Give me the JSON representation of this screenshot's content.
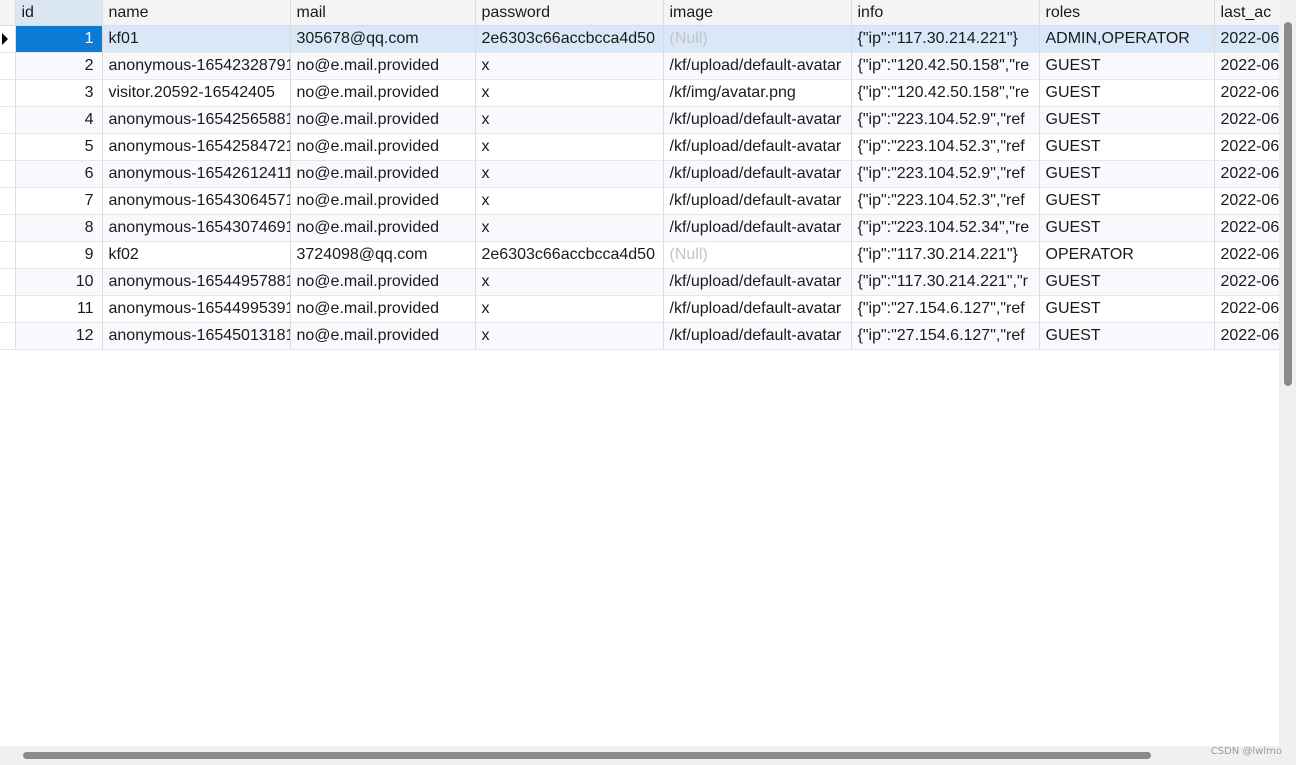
{
  "columns": [
    "id",
    "name",
    "mail",
    "password",
    "image",
    "info",
    "roles",
    "last_ac"
  ],
  "rows": [
    {
      "id": "1",
      "name": "kf01",
      "mail": "305678@qq.com",
      "password": "2e6303c66accbcca4d50",
      "image": "(Null)",
      "info": "{\"ip\":\"117.30.214.221\"}",
      "roles": "ADMIN,OPERATOR",
      "last_ac": "2022-06"
    },
    {
      "id": "2",
      "name": "anonymous-16542328791",
      "mail": "no@e.mail.provided",
      "password": "x",
      "image": "/kf/upload/default-avatar",
      "info": "{\"ip\":\"120.42.50.158\",\"re",
      "roles": "GUEST",
      "last_ac": "2022-06"
    },
    {
      "id": "3",
      "name": "visitor.20592-16542405",
      "mail": "no@e.mail.provided",
      "password": "x",
      "image": "/kf/img/avatar.png",
      "info": "{\"ip\":\"120.42.50.158\",\"re",
      "roles": "GUEST",
      "last_ac": "2022-06"
    },
    {
      "id": "4",
      "name": "anonymous-16542565881",
      "mail": "no@e.mail.provided",
      "password": "x",
      "image": "/kf/upload/default-avatar",
      "info": "{\"ip\":\"223.104.52.9\",\"ref",
      "roles": "GUEST",
      "last_ac": "2022-06"
    },
    {
      "id": "5",
      "name": "anonymous-16542584721",
      "mail": "no@e.mail.provided",
      "password": "x",
      "image": "/kf/upload/default-avatar",
      "info": "{\"ip\":\"223.104.52.3\",\"ref",
      "roles": "GUEST",
      "last_ac": "2022-06"
    },
    {
      "id": "6",
      "name": "anonymous-16542612411",
      "mail": "no@e.mail.provided",
      "password": "x",
      "image": "/kf/upload/default-avatar",
      "info": "{\"ip\":\"223.104.52.9\",\"ref",
      "roles": "GUEST",
      "last_ac": "2022-06"
    },
    {
      "id": "7",
      "name": "anonymous-16543064571",
      "mail": "no@e.mail.provided",
      "password": "x",
      "image": "/kf/upload/default-avatar",
      "info": "{\"ip\":\"223.104.52.3\",\"ref",
      "roles": "GUEST",
      "last_ac": "2022-06"
    },
    {
      "id": "8",
      "name": "anonymous-16543074691",
      "mail": "no@e.mail.provided",
      "password": "x",
      "image": "/kf/upload/default-avatar",
      "info": "{\"ip\":\"223.104.52.34\",\"re",
      "roles": "GUEST",
      "last_ac": "2022-06"
    },
    {
      "id": "9",
      "name": "kf02",
      "mail": "3724098@qq.com",
      "password": "2e6303c66accbcca4d50",
      "image": "(Null)",
      "info": "{\"ip\":\"117.30.214.221\"}",
      "roles": "OPERATOR",
      "last_ac": "2022-06"
    },
    {
      "id": "10",
      "name": "anonymous-16544957881",
      "mail": "no@e.mail.provided",
      "password": "x",
      "image": "/kf/upload/default-avatar",
      "info": "{\"ip\":\"117.30.214.221\",\"r",
      "roles": "GUEST",
      "last_ac": "2022-06"
    },
    {
      "id": "11",
      "name": "anonymous-16544995391",
      "mail": "no@e.mail.provided",
      "password": "x",
      "image": "/kf/upload/default-avatar",
      "info": "{\"ip\":\"27.154.6.127\",\"ref",
      "roles": "GUEST",
      "last_ac": "2022-06"
    },
    {
      "id": "12",
      "name": "anonymous-16545013181",
      "mail": "no@e.mail.provided",
      "password": "x",
      "image": "/kf/upload/default-avatar",
      "info": "{\"ip\":\"27.154.6.127\",\"ref",
      "roles": "GUEST",
      "last_ac": "2022-06"
    }
  ],
  "current_row_index": 0,
  "null_value": "(Null)",
  "icons": {
    "row_indicator": "current-row-arrow-icon"
  },
  "colors": {
    "selected_cell": "#0c7bd6",
    "selected_row": "#d8e8f8",
    "null_text": "#c4c4c4",
    "header_bg": "#f4f4f4"
  },
  "watermark": "CSDN @lwlmo"
}
